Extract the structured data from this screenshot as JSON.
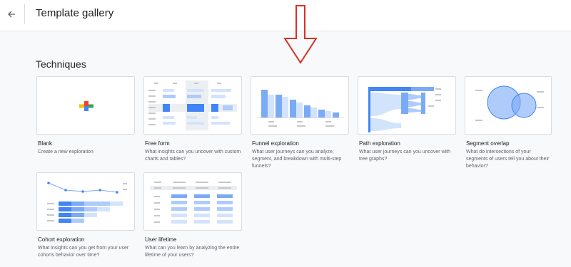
{
  "header": {
    "title": "Template gallery"
  },
  "section": {
    "title": "Techniques"
  },
  "cards": [
    {
      "title": "Blank",
      "desc": "Create a new exploration"
    },
    {
      "title": "Free form",
      "desc": "What insights can you uncover with custom charts and tables?"
    },
    {
      "title": "Funnel exploration",
      "desc": "What user journeys can you analyze, segment, and breakdown with multi-step funnels?"
    },
    {
      "title": "Path exploration",
      "desc": "What user journeys can you uncover with tree graphs?"
    },
    {
      "title": "Segment overlap",
      "desc": "What do intersections of your segments of users tell you about their behavior?"
    },
    {
      "title": "Cohort exploration",
      "desc": "What insights can you get from your user cohorts behavior over time?"
    },
    {
      "title": "User lifetime",
      "desc": "What can you learn by analyzing the entire lifetime of your users?"
    }
  ],
  "colors": {
    "accent": "#7baaf7",
    "accent_dark": "#4285f4",
    "arrow": "#d93025"
  }
}
